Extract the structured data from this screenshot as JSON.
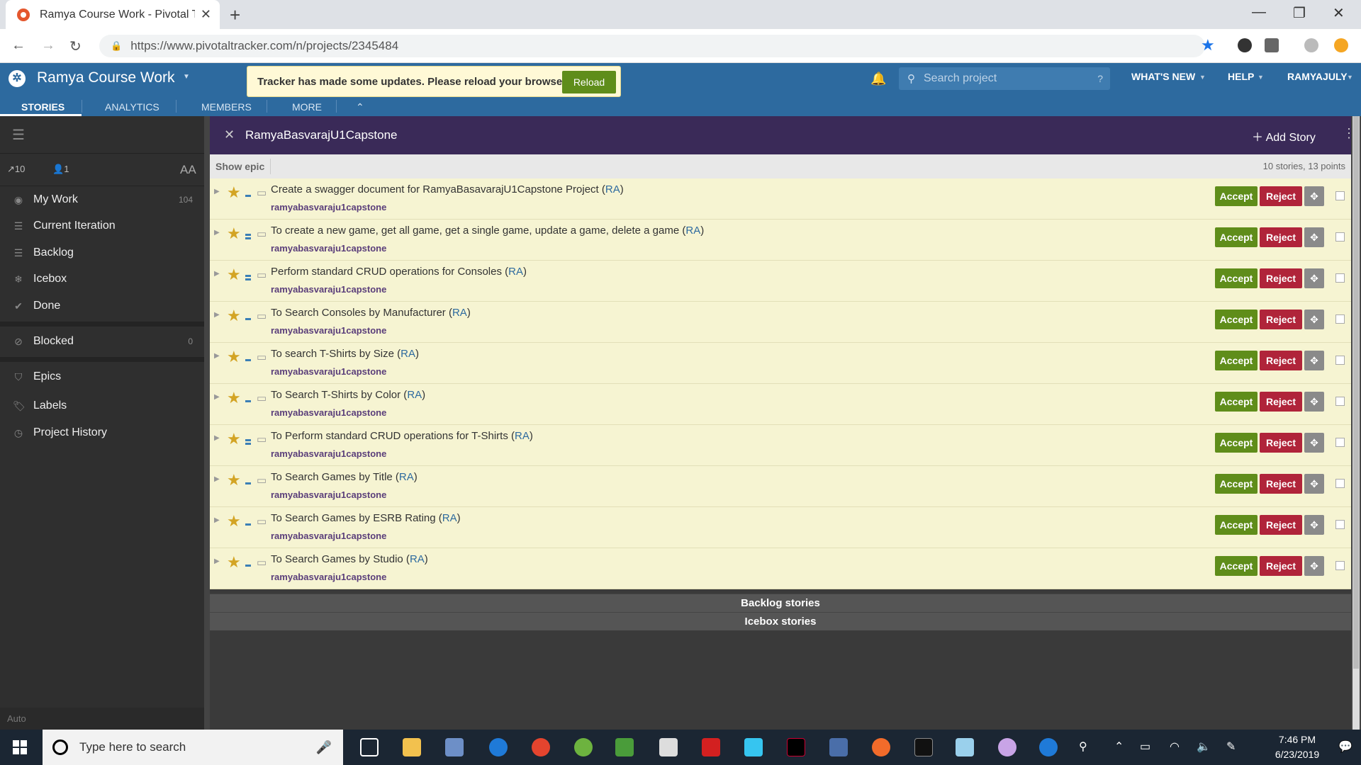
{
  "browser": {
    "tab_title": "Ramya Course Work - Pivotal Tra",
    "url": "https://www.pivotaltracker.com/n/projects/2345484"
  },
  "header": {
    "project_name": "Ramya Course Work",
    "tabs": [
      "STORIES",
      "ANALYTICS",
      "MEMBERS",
      "MORE"
    ],
    "banner_message": "Tracker has made some updates. Please reload your browser.",
    "reload_label": "Reload",
    "search_placeholder": "Search project",
    "search_help": "?",
    "whats_new": "WHAT'S NEW",
    "help": "HELP",
    "user": "RAMYAJULY"
  },
  "sidebar": {
    "velocity": "10",
    "members": "1",
    "font_toggle": "AA",
    "items": [
      {
        "label": "My Work",
        "count": "104",
        "icon": "my-work-icon"
      },
      {
        "label": "Current Iteration",
        "count": "",
        "icon": "list-icon"
      },
      {
        "label": "Backlog",
        "count": "",
        "icon": "list-icon"
      },
      {
        "label": "Icebox",
        "count": "",
        "icon": "snowflake-icon"
      },
      {
        "label": "Done",
        "count": "",
        "icon": "check-icon"
      },
      {
        "label": "Blocked",
        "count": "0",
        "icon": "blocked-icon"
      },
      {
        "label": "Epics",
        "count": "",
        "icon": "shield-icon"
      },
      {
        "label": "Labels",
        "count": "",
        "icon": "tag-icon"
      },
      {
        "label": "Project History",
        "count": "",
        "icon": "clock-icon"
      }
    ],
    "footer_label": "Auto"
  },
  "panel": {
    "title": "RamyaBasvarajU1Capstone",
    "add_story": "Add Story",
    "show_epic": "Show epic",
    "summary": "10 stories, 13 points",
    "accept_label": "Accept",
    "reject_label": "Reject",
    "stories": [
      {
        "name": "Create a swagger document for RamyaBasavarajU1Capstone Project",
        "owner": "RA",
        "label": "ramyabasvaraju1capstone",
        "points": 1
      },
      {
        "name": "To create a new game, get all game, get a single game, update a game, delete a game",
        "owner": "RA",
        "label": "ramyabasvaraju1capstone",
        "points": 2
      },
      {
        "name": "Perform standard CRUD operations for Consoles",
        "owner": "RA",
        "label": "ramyabasvaraju1capstone",
        "points": 2
      },
      {
        "name": "To Search Consoles by Manufacturer",
        "owner": "RA",
        "label": "ramyabasvaraju1capstone",
        "points": 1
      },
      {
        "name": "To search T-Shirts by Size",
        "owner": "RA",
        "label": "ramyabasvaraju1capstone",
        "points": 1
      },
      {
        "name": "To Search T-Shirts by Color",
        "owner": "RA",
        "label": "ramyabasvaraju1capstone",
        "points": 1
      },
      {
        "name": "To Perform standard CRUD operations for T-Shirts",
        "owner": "RA",
        "label": "ramyabasvaraju1capstone",
        "points": 2
      },
      {
        "name": "To Search Games by Title",
        "owner": "RA",
        "label": "ramyabasvaraju1capstone",
        "points": 1
      },
      {
        "name": "To Search Games by ESRB Rating",
        "owner": "RA",
        "label": "ramyabasvaraju1capstone",
        "points": 1
      },
      {
        "name": "To Search Games by Studio",
        "owner": "RA",
        "label": "ramyabasvaraju1capstone",
        "points": 1
      }
    ],
    "backlog_section": "Backlog stories",
    "icebox_section": "Icebox stories"
  },
  "taskbar": {
    "search_placeholder": "Type here to search",
    "time": "7:46 PM",
    "date": "6/23/2019"
  },
  "colors": {
    "app_header": "#2d6a9f",
    "panel_header": "#3a2a58",
    "story_bg": "#f6f4d2",
    "accept": "#5f8d1a",
    "reject": "#b0243a"
  }
}
